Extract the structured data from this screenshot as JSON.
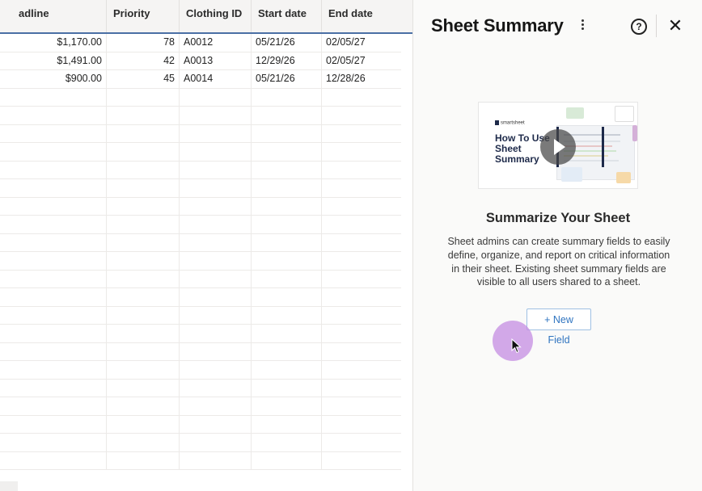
{
  "grid": {
    "columns": [
      {
        "label": "adline"
      },
      {
        "label": "Priority"
      },
      {
        "label": "Clothing ID"
      },
      {
        "label": "Start date"
      },
      {
        "label": "End date"
      }
    ],
    "rows": [
      {
        "headline": "$1,170.00",
        "priority": "78",
        "clothing_id": "A0012",
        "start": "05/21/26",
        "end": "02/05/27"
      },
      {
        "headline": "$1,491.00",
        "priority": "42",
        "clothing_id": "A0013",
        "start": "12/29/26",
        "end": "02/05/27"
      },
      {
        "headline": "$900.00",
        "priority": "45",
        "clothing_id": "A0014",
        "start": "05/21/26",
        "end": "12/28/26"
      }
    ]
  },
  "panel": {
    "title": "Sheet Summary",
    "help_glyph": "?",
    "close_glyph": "✕",
    "video": {
      "brand": "smartsheet",
      "title": "How To Use Sheet Summary"
    },
    "heading": "Summarize Your Sheet",
    "description": "Sheet admins can create summary fields to easily define, organize, and report on critical information in their sheet. Existing sheet summary fields are visible to all users shared to a sheet.",
    "new_field_label": "+ New Field"
  },
  "colors": {
    "accent": "#2f74c0",
    "header_border": "#4a6fa5",
    "cursor_halo": "#c48ce2"
  }
}
